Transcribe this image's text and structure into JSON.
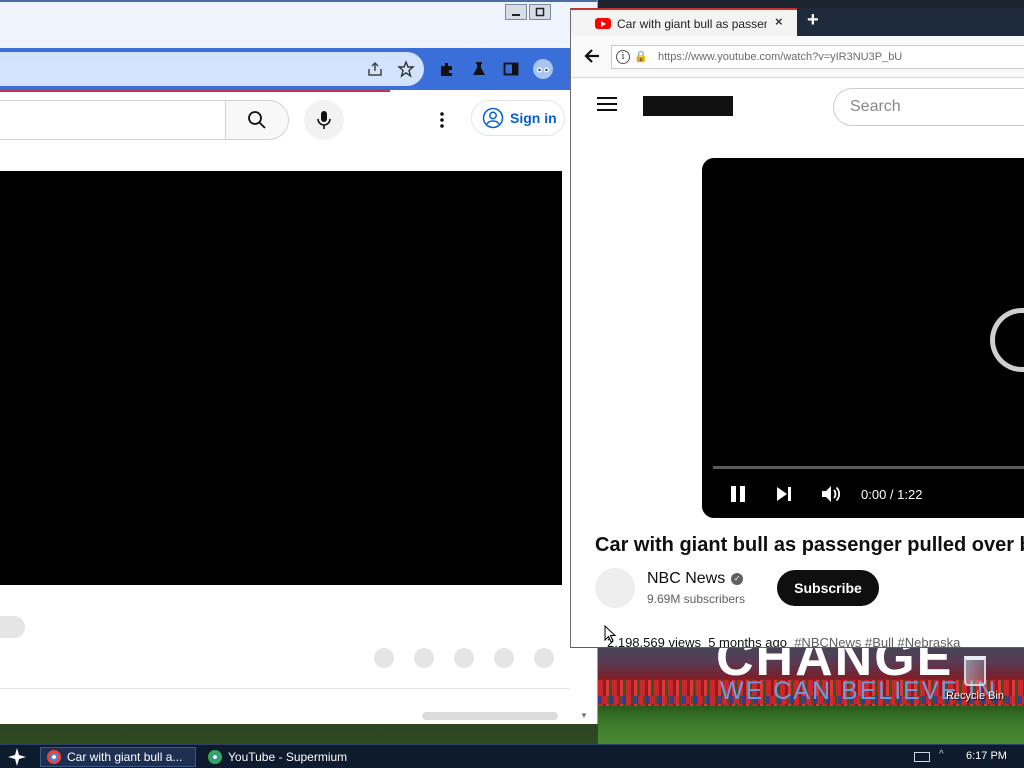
{
  "desktop": {
    "wallpaper_line1": "CHANGE",
    "wallpaper_line2": "WE CAN BELIEVE IN",
    "recycle_bin_label": "Recycle Bin"
  },
  "left_window": {
    "browser": "Supermium",
    "sign_in_label": "Sign in",
    "accent_color": "#3a6ed8",
    "icons": [
      "share-icon",
      "star-icon",
      "extensions-icon",
      "lab-icon",
      "sidebar-icon",
      "profile-icon",
      "search-icon",
      "mic-icon",
      "more-vert-icon",
      "account-icon"
    ]
  },
  "right_window": {
    "tab_title": "Car with giant bull as passeng...",
    "tab_close": "×",
    "new_tab": "+",
    "url": "https://www.youtube.com/watch?v=yIR3NU3P_bU",
    "search_placeholder": "Search",
    "player": {
      "time": "0:00 / 1:22",
      "state": "loading"
    },
    "video_title": "Car with giant bull as passenger pulled over b",
    "channel_name": "NBC News",
    "channel_verified_mark": "✓",
    "subscribers": "9.69M subscribers",
    "subscribe_label": "Subscribe",
    "views": "2,198,569 views",
    "age": "5 months ago",
    "hashtags": "#NBCNews #Bull #Nebraska"
  },
  "taskbar": {
    "items": [
      {
        "label": "Car with giant bull a...",
        "active": true
      },
      {
        "label": "YouTube - Supermium",
        "active": false
      }
    ],
    "clock": "6:17 PM",
    "tray_chevron": "^"
  }
}
